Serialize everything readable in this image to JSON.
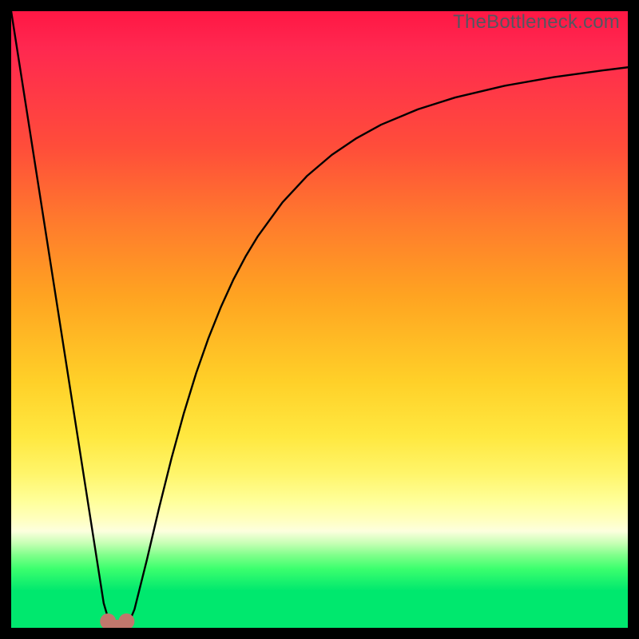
{
  "watermark": "TheBottleneck.com",
  "colors": {
    "background": "#000000",
    "curve_stroke": "#000000",
    "marker_fill": "#c1776c",
    "watermark": "#555560"
  },
  "chart_data": {
    "type": "line",
    "title": "",
    "xlabel": "",
    "ylabel": "",
    "xlim": [
      0,
      100
    ],
    "ylim": [
      0,
      100
    ],
    "legend": false,
    "grid": false,
    "annotations": [],
    "series": [
      {
        "name": "bottleneck-curve",
        "x": [
          0,
          2,
          4,
          6,
          8,
          10,
          12,
          14,
          15,
          16,
          17,
          18,
          19,
          20,
          22,
          24,
          26,
          28,
          30,
          32,
          34,
          36,
          38,
          40,
          44,
          48,
          52,
          56,
          60,
          66,
          72,
          80,
          88,
          96,
          100
        ],
        "y": [
          100,
          87.2,
          74.4,
          61.6,
          48.8,
          36.0,
          23.2,
          10.4,
          4.0,
          0.6,
          0.0,
          0.0,
          0.6,
          3.0,
          11.0,
          19.5,
          27.5,
          34.8,
          41.3,
          47.0,
          52.0,
          56.4,
          60.2,
          63.5,
          69.0,
          73.3,
          76.7,
          79.4,
          81.6,
          84.1,
          86.0,
          87.9,
          89.3,
          90.4,
          90.9
        ]
      }
    ],
    "markers": [
      {
        "name": "valley-left",
        "x": 15.7,
        "y": 0.0
      },
      {
        "name": "valley-right",
        "x": 18.7,
        "y": 0.0
      }
    ],
    "gradient_stops_percent_to_color": [
      [
        0,
        "#ff1744"
      ],
      [
        22,
        "#ff4d3a"
      ],
      [
        46,
        "#ffa321"
      ],
      [
        69,
        "#ffe840"
      ],
      [
        82,
        "#ffffc0"
      ],
      [
        88,
        "#7dff89"
      ],
      [
        94,
        "#00e86e"
      ],
      [
        100,
        "#00e86e"
      ]
    ]
  }
}
